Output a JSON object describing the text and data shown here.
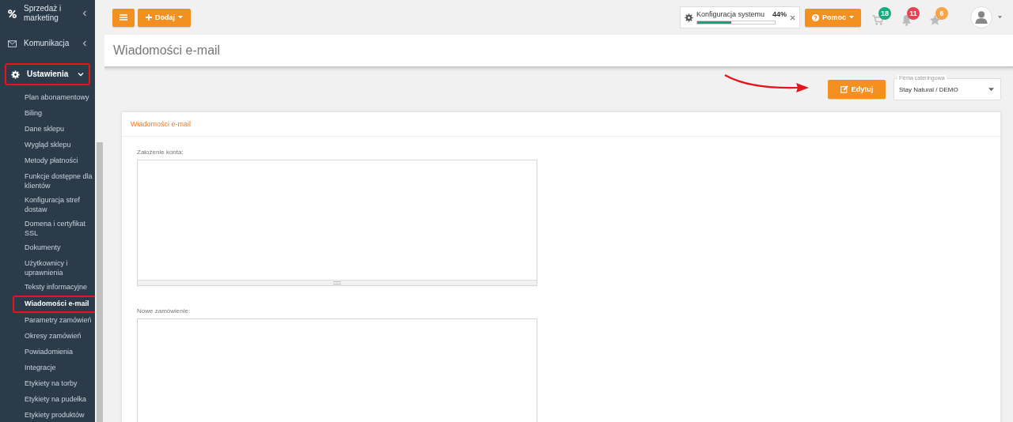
{
  "sidebar": {
    "top_items": [
      {
        "label": "Sprzedaż i marketing",
        "expanded": false,
        "outlined": false
      },
      {
        "label": "Komunikacja",
        "expanded": false,
        "outlined": false
      },
      {
        "label": "Ustawienia",
        "expanded": true,
        "outlined": true
      }
    ],
    "items": [
      {
        "label": "Plan abonamentowy",
        "selected": false,
        "outlined": false
      },
      {
        "label": "Biling",
        "selected": false,
        "outlined": false
      },
      {
        "label": "Dane sklepu",
        "selected": false,
        "outlined": false
      },
      {
        "label": "Wygląd sklepu",
        "selected": false,
        "outlined": false
      },
      {
        "label": "Metody płatności",
        "selected": false,
        "outlined": false
      },
      {
        "label": "Funkcje dostępne dla klientów",
        "selected": false,
        "outlined": false
      },
      {
        "label": "Konfiguracja stref dostaw",
        "selected": false,
        "outlined": false
      },
      {
        "label": "Domena i certyfikat SSL",
        "selected": false,
        "outlined": false
      },
      {
        "label": "Dokumenty",
        "selected": false,
        "outlined": false
      },
      {
        "label": "Użytkownicy i uprawnienia",
        "selected": false,
        "outlined": false
      },
      {
        "label": "Teksty informacyjne",
        "selected": false,
        "outlined": false
      },
      {
        "label": "Wiadomości e-mail",
        "selected": true,
        "outlined": true
      },
      {
        "label": "Parametry zamówień",
        "selected": false,
        "outlined": false
      },
      {
        "label": "Okresy zamówień",
        "selected": false,
        "outlined": false
      },
      {
        "label": "Powiadomienia",
        "selected": false,
        "outlined": false
      },
      {
        "label": "Integracje",
        "selected": false,
        "outlined": false
      },
      {
        "label": "Etykiety na torby",
        "selected": false,
        "outlined": false
      },
      {
        "label": "Etykiety na pudełka",
        "selected": false,
        "outlined": false
      },
      {
        "label": "Etykiety produktów",
        "selected": false,
        "outlined": false
      }
    ]
  },
  "topbar": {
    "add_button": "Dodaj",
    "config": {
      "label": "Konfiguracja systemu",
      "percent": "44%",
      "level": 0.44
    },
    "help_button": "Pomoc",
    "badges": [
      {
        "count": "18",
        "color": "#1aaa7f"
      },
      {
        "count": "11",
        "color": "#e8414f"
      },
      {
        "count": "6",
        "color": "#f7a34a"
      }
    ]
  },
  "page_title": "Wiadomości e-mail",
  "toolbar": {
    "edit_button": "Edytuj",
    "company_select": {
      "label": "Firma cateringowa",
      "value": "Stay Natural / DEMO"
    }
  },
  "card": {
    "title": "Wiadomości e-mail",
    "fields": [
      {
        "label": "Założenie konta:"
      },
      {
        "label": "Nowe zamówienie:"
      }
    ]
  }
}
